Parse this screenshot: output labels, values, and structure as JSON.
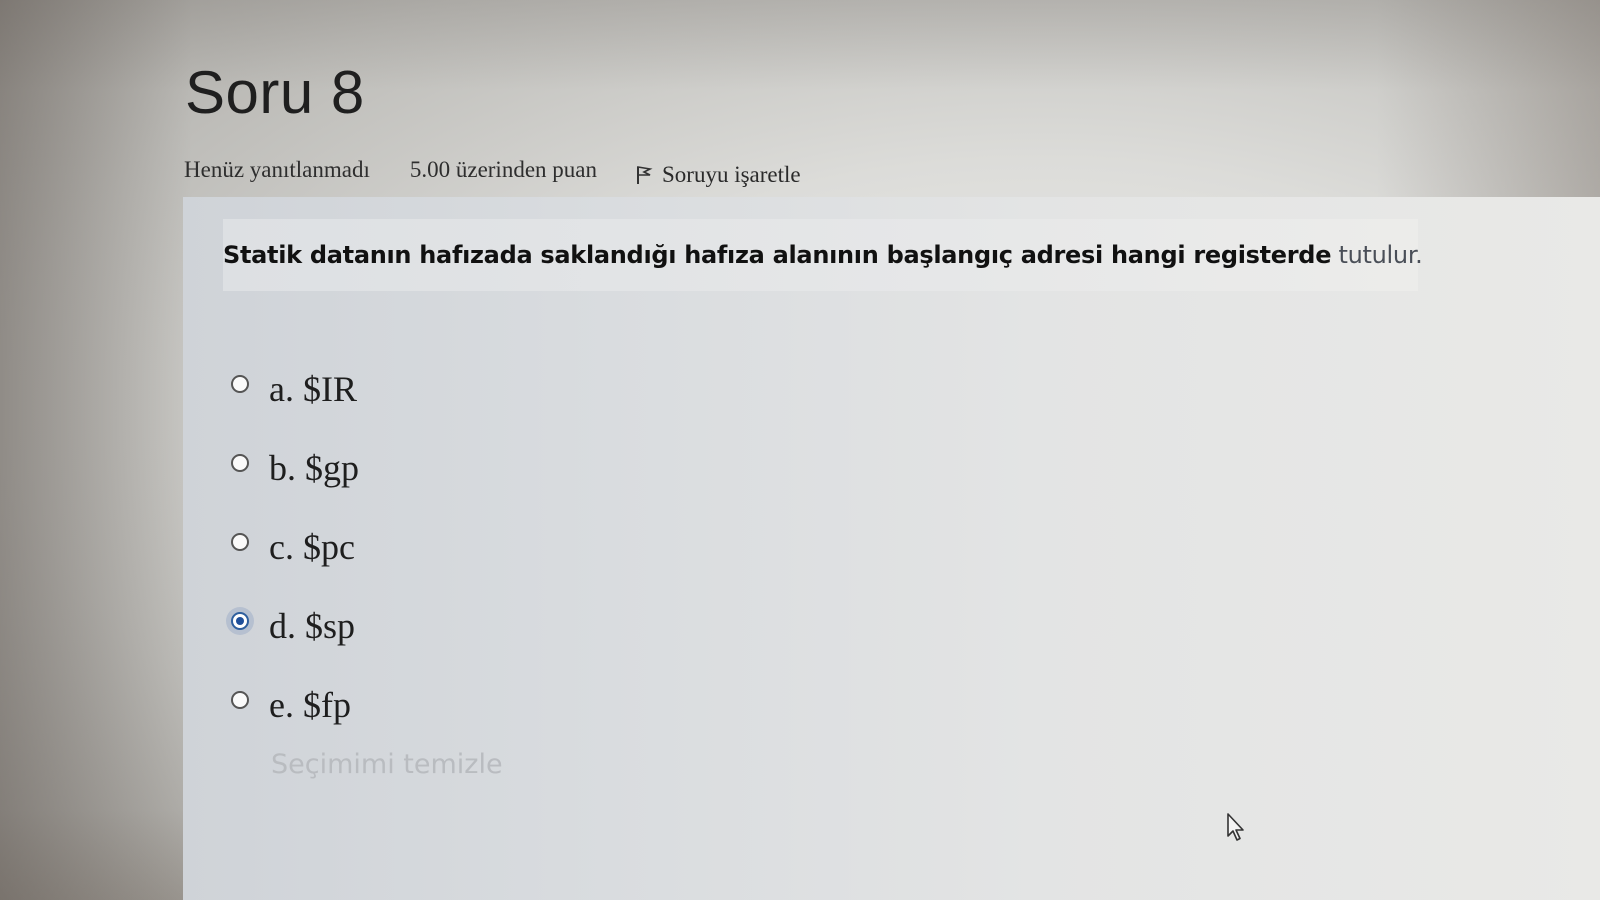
{
  "question": {
    "title": "Soru 8",
    "status": "Henüz yanıtlanmadı",
    "mark": "5.00 üzerinden puan",
    "flag_label": "Soruyu işaretle",
    "text_main": "Statik datanın hafızada saklandığı hafıza alanının başlangıç adresi hangi registerde",
    "text_tail": " tutulur."
  },
  "answers": [
    {
      "label": "a. $IR",
      "selected": false
    },
    {
      "label": "b. $gp",
      "selected": false
    },
    {
      "label": "c. $pc",
      "selected": false
    },
    {
      "label": "d. $sp",
      "selected": true
    },
    {
      "label": "e. $fp",
      "selected": false
    }
  ],
  "clear_choice_label": "Seçimimi temizle",
  "icons": {
    "flag": "flag-icon",
    "radio": "radio-icon",
    "cursor": "mouse-pointer-icon"
  },
  "colors": {
    "selected_radio": "#1f4f9a",
    "question_background": "#d9dcdf",
    "clear_choice_text": "#b9bcc0"
  }
}
